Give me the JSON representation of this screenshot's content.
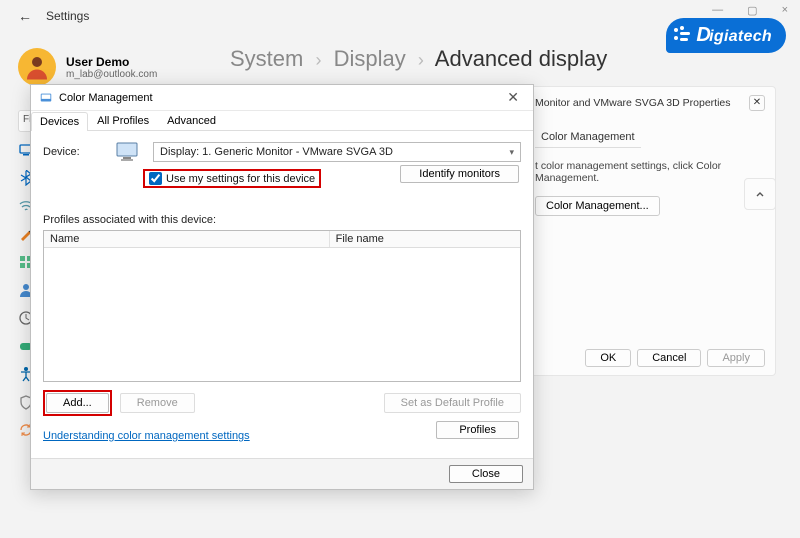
{
  "window": {
    "settings_label": "Settings",
    "min": "—",
    "max": "▢",
    "close": "×"
  },
  "watermark": "igiatech",
  "user": {
    "name": "User Demo",
    "email": "m_lab@outlook.com"
  },
  "breadcrumb": {
    "a": "System",
    "b": "Display",
    "c": "Advanced display"
  },
  "search_stub": "Fi",
  "props": {
    "title": "Monitor and VMware SVGA 3D Properties",
    "tab": "Color Management",
    "desc": "t color management settings, click Color Management.",
    "cm_btn": "Color Management...",
    "ok": "OK",
    "cancel": "Cancel",
    "apply": "Apply"
  },
  "cm": {
    "title": "Color Management",
    "tabs": {
      "devices": "Devices",
      "all": "All Profiles",
      "advanced": "Advanced"
    },
    "device_label": "Device:",
    "device_value": "Display: 1. Generic Monitor - VMware SVGA 3D",
    "use_my": "Use my settings for this device",
    "identify": "Identify monitors",
    "assoc": "Profiles associated with this device:",
    "col_name": "Name",
    "col_file": "File name",
    "add": "Add...",
    "remove": "Remove",
    "set_default": "Set as Default Profile",
    "profiles_btn": "Profiles",
    "link": "Understanding color management settings",
    "close": "Close"
  }
}
